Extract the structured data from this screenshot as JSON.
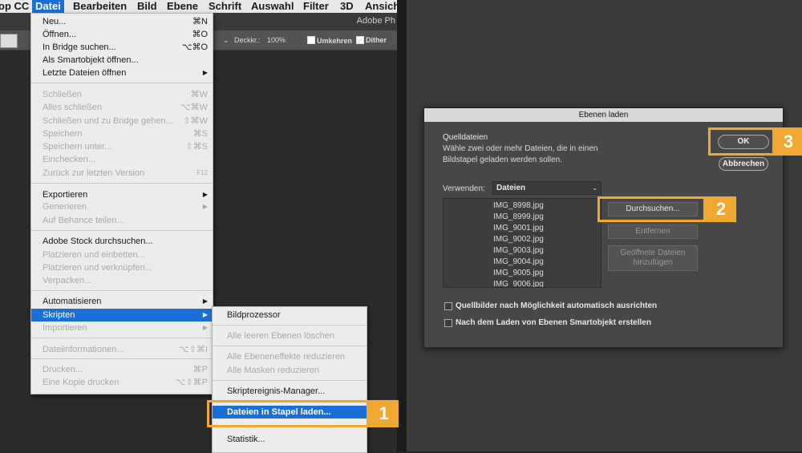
{
  "menubar": {
    "items": [
      "op CC",
      "Datei",
      "Bearbeiten",
      "Bild",
      "Ebene",
      "Schrift",
      "Auswahl",
      "Filter",
      "3D",
      "Ansich"
    ],
    "active_index": 1
  },
  "app_title": "Adobe Ph",
  "optionsbar": {
    "opacity_label": "Deckkr.:",
    "opacity_value": "100%",
    "reverse_label": "Umkehren",
    "dither_label": "Dither"
  },
  "file_menu": {
    "rows": [
      {
        "label": "Neu...",
        "shortcut": "⌘N"
      },
      {
        "label": "Öffnen...",
        "shortcut": "⌘O"
      },
      {
        "label": "In Bridge suchen...",
        "shortcut": "⌥⌘O"
      },
      {
        "label": "Als Smartobjekt öffnen...",
        "shortcut": ""
      },
      {
        "label": "Letzte Dateien öffnen",
        "shortcut": "▶"
      },
      {
        "label": "Schließen",
        "shortcut": "⌘W"
      },
      {
        "label": "Alles schließen",
        "shortcut": "⌥⌘W"
      },
      {
        "label": "Schließen und zu Bridge gehen...",
        "shortcut": "⇧⌘W"
      },
      {
        "label": "Speichern",
        "shortcut": "⌘S"
      },
      {
        "label": "Speichern unter...",
        "shortcut": "⇧⌘S"
      },
      {
        "label": "Einchecken...",
        "shortcut": ""
      },
      {
        "label": "Zurück zur letzten Version",
        "shortcut": "F12"
      },
      {
        "label": "Exportieren",
        "shortcut": "▶"
      },
      {
        "label": "Generieren",
        "shortcut": "▶"
      },
      {
        "label": "Auf Behance teilen...",
        "shortcut": ""
      },
      {
        "label": "Adobe Stock durchsuchen...",
        "shortcut": ""
      },
      {
        "label": "Platzieren und einbetten...",
        "shortcut": ""
      },
      {
        "label": "Platzieren und verknüpfen...",
        "shortcut": ""
      },
      {
        "label": "Verpacken...",
        "shortcut": ""
      },
      {
        "label": "Automatisieren",
        "shortcut": "▶"
      },
      {
        "label": "Skripten",
        "shortcut": "▶"
      },
      {
        "label": "Importieren",
        "shortcut": "▶"
      },
      {
        "label": "Dateiinformationen...",
        "shortcut": "⌥⇧⌘I"
      },
      {
        "label": "Drucken...",
        "shortcut": "⌘P"
      },
      {
        "label": "Eine Kopie drucken",
        "shortcut": "⌥⇧⌘P"
      }
    ]
  },
  "scripts_submenu": {
    "rows": [
      {
        "label": "Bildprozessor"
      },
      {
        "label": "Alle leeren Ebenen löschen"
      },
      {
        "label": "Alle Ebeneneffekte reduzieren"
      },
      {
        "label": "Alle Masken reduzieren"
      },
      {
        "label": "Skriptereignis-Manager..."
      },
      {
        "label": "Dateien in Stapel laden..."
      },
      {
        "label": "Statistik..."
      }
    ]
  },
  "dialog": {
    "title": "Ebenen laden",
    "section_title": "Quelldateien",
    "description_line1": "Wähle zwei oder mehr Dateien, die in einen",
    "description_line2": "Bildstapel geladen werden sollen.",
    "use_label": "Verwenden:",
    "use_value": "Dateien",
    "files": [
      "IMG_8998.jpg",
      "IMG_8999.jpg",
      "IMG_9001.jpg",
      "IMG_9002.jpg",
      "IMG_9003.jpg",
      "IMG_9004.jpg",
      "IMG_9005.jpg",
      "IMG_9006.jpg"
    ],
    "browse_label": "Durchsuchen...",
    "remove_label": "Entfernen",
    "add_open_line1": "Geöffnete Dateien",
    "add_open_line2": "hinzufügen",
    "ok_label": "OK",
    "cancel_label": "Abbrechen",
    "auto_align_label": "Quellbilder nach Möglichkeit automatisch ausrichten",
    "smart_object_label": "Nach dem Laden von Ebenen Smartobjekt erstellen"
  },
  "callouts": [
    "1",
    "2",
    "3"
  ],
  "colors": {
    "accent": "#f0a830",
    "highlight": "#1a6fd6"
  }
}
